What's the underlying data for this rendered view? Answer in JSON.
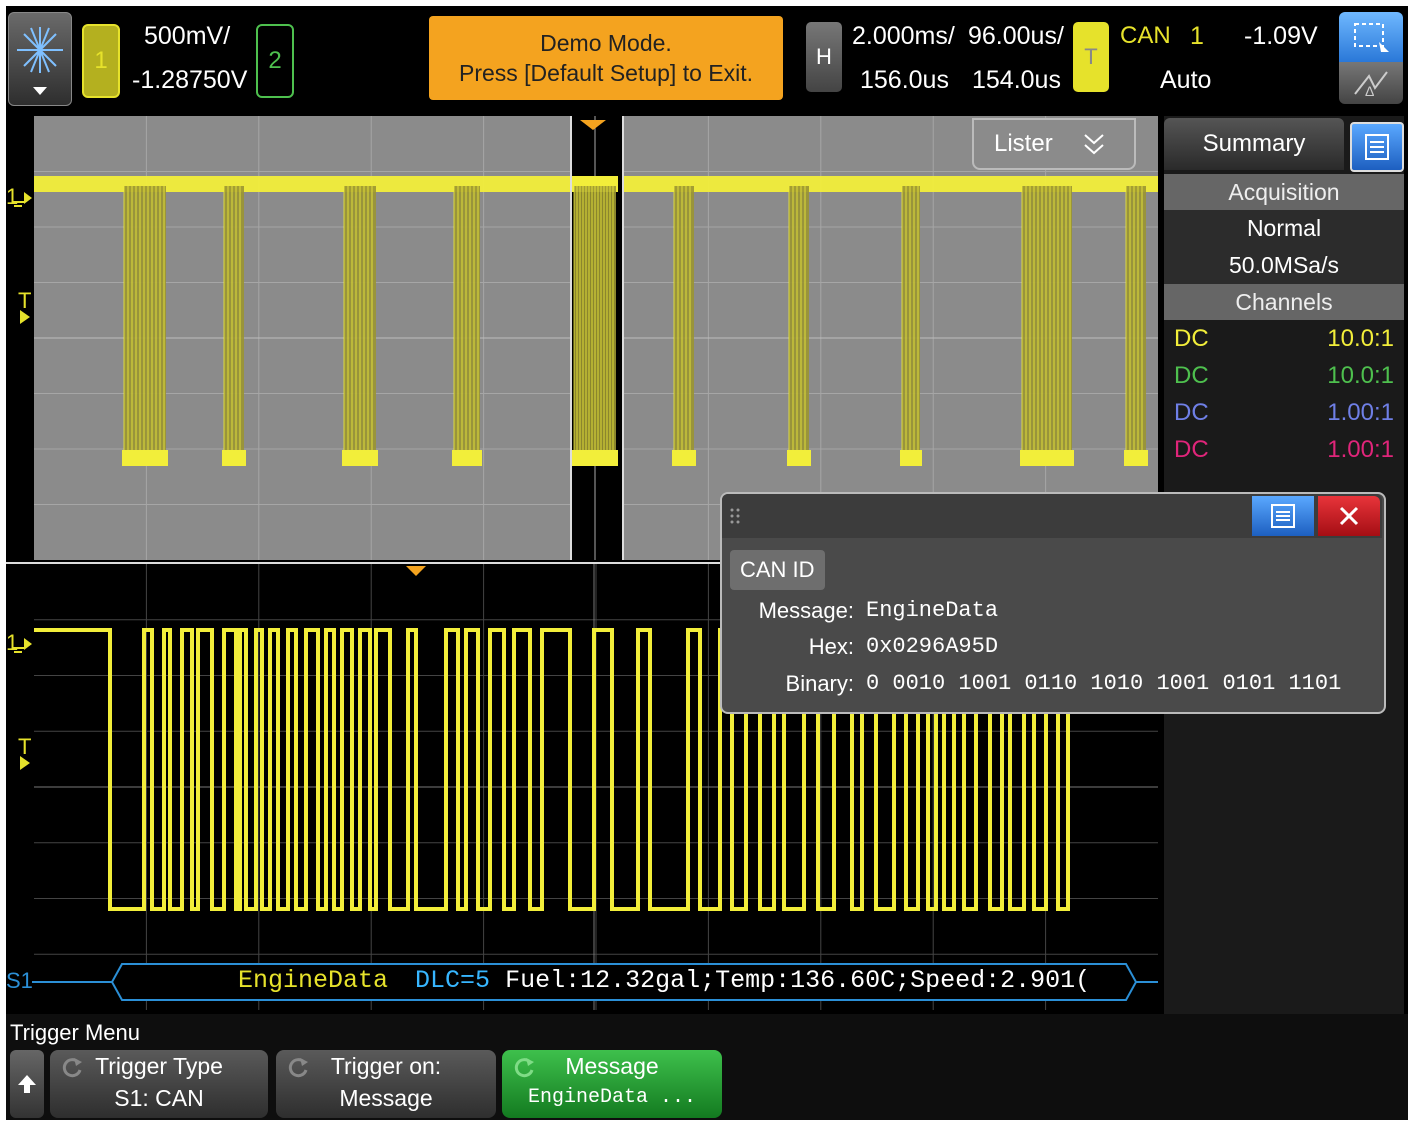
{
  "header": {
    "ch1_number": "1",
    "ch1_scale": "500mV/",
    "ch1_offset": "-1.28750V",
    "ch2_number": "2",
    "demo_line1": "Demo Mode.",
    "demo_line2": "Press [Default Setup] to Exit.",
    "h_label": "H",
    "timebase_scale": "2.000ms/",
    "timebase_delay": "96.00us/",
    "zoom_scale": "156.0us",
    "zoom_delay": "154.0us",
    "t_label": "T",
    "trigger_source": "CAN",
    "trigger_channel": "1",
    "trigger_level": "-1.09V",
    "trigger_mode": "Auto"
  },
  "main_window": {
    "lister_label": "Lister",
    "trigger_marker": "T",
    "ground_marker": "1"
  },
  "zoom_window": {
    "trigger_marker": "T",
    "ground_marker": "1",
    "serial_label": "S1",
    "decode_name": "EngineData",
    "decode_dlc": "DLC=5",
    "decode_payload": "Fuel:12.32gal;Temp:136.60C;Speed:2.901("
  },
  "sidebar": {
    "summary_tab": "Summary",
    "acquisition_header": "Acquisition",
    "acq_mode": "Normal",
    "acq_rate": "50.0MSa/s",
    "channels_header": "Channels",
    "channels": [
      {
        "coupling": "DC",
        "probe": "10.0:1",
        "color": "#f2ee3a"
      },
      {
        "coupling": "DC",
        "probe": "10.0:1",
        "color": "#4ec04e"
      },
      {
        "coupling": "DC",
        "probe": "1.00:1",
        "color": "#6f7fe6"
      },
      {
        "coupling": "DC",
        "probe": "1.00:1",
        "color": "#e0257a"
      }
    ]
  },
  "popup": {
    "field_name": "CAN ID",
    "message_label": "Message:",
    "message_value": "EngineData",
    "hex_label": "Hex:",
    "hex_value": "0x0296A95D",
    "binary_label": "Binary:",
    "binary_value": "0 0010 1001 0110 1010 1001 0101 1101"
  },
  "bottom": {
    "menu_title": "Trigger Menu",
    "softkeys": [
      {
        "line1": "Trigger Type",
        "line2": "S1: CAN"
      },
      {
        "line1": "Trigger on:",
        "line2": "Message"
      },
      {
        "line1": "Message",
        "line2": "EngineData ..."
      }
    ]
  },
  "colors": {
    "ch1": "#f2ee3a",
    "ch2": "#4ec04e",
    "ch3": "#6f7fe6",
    "ch4": "#e0257a",
    "demo": "#f4a31f",
    "softkey_active": "#1f9c2c",
    "decode_bus": "#2b8fd6"
  }
}
